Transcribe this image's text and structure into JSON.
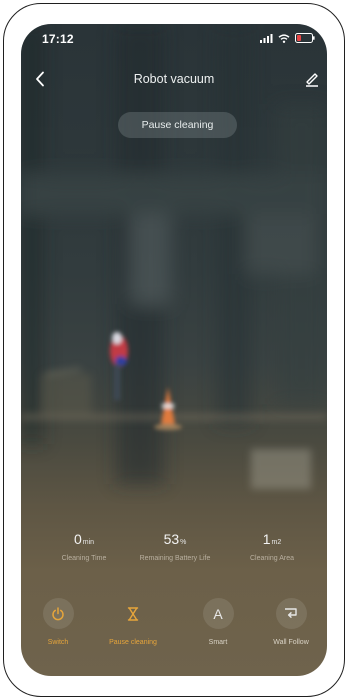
{
  "status_bar": {
    "time": "17:12",
    "icons": [
      "signal-icon",
      "wifi-icon",
      "battery-icon"
    ]
  },
  "header": {
    "title": "Robot vacuum",
    "back_icon": "back-chevron-icon",
    "edit_icon": "edit-icon"
  },
  "status_pill": "Pause cleaning",
  "stats": [
    {
      "value": "0",
      "unit": "min",
      "label": "Cleaning Time"
    },
    {
      "value": "53",
      "unit": "%",
      "label": "Remaining Battery Life"
    },
    {
      "value": "1",
      "unit": "m2",
      "label": "Cleaning Area"
    }
  ],
  "controls": [
    {
      "label": "Switch",
      "icon": "power-icon",
      "active": true
    },
    {
      "label": "Pause cleaning",
      "icon": "hourglass-icon",
      "active": true
    },
    {
      "label": "Smart",
      "icon": "letter-a-icon",
      "active": false
    },
    {
      "label": "Wall Follow",
      "icon": "wall-follow-icon",
      "active": false
    }
  ],
  "colors": {
    "accent": "#e6a53b",
    "text_light": "#f3f3f3",
    "text_muted": "#b9b0a0"
  }
}
